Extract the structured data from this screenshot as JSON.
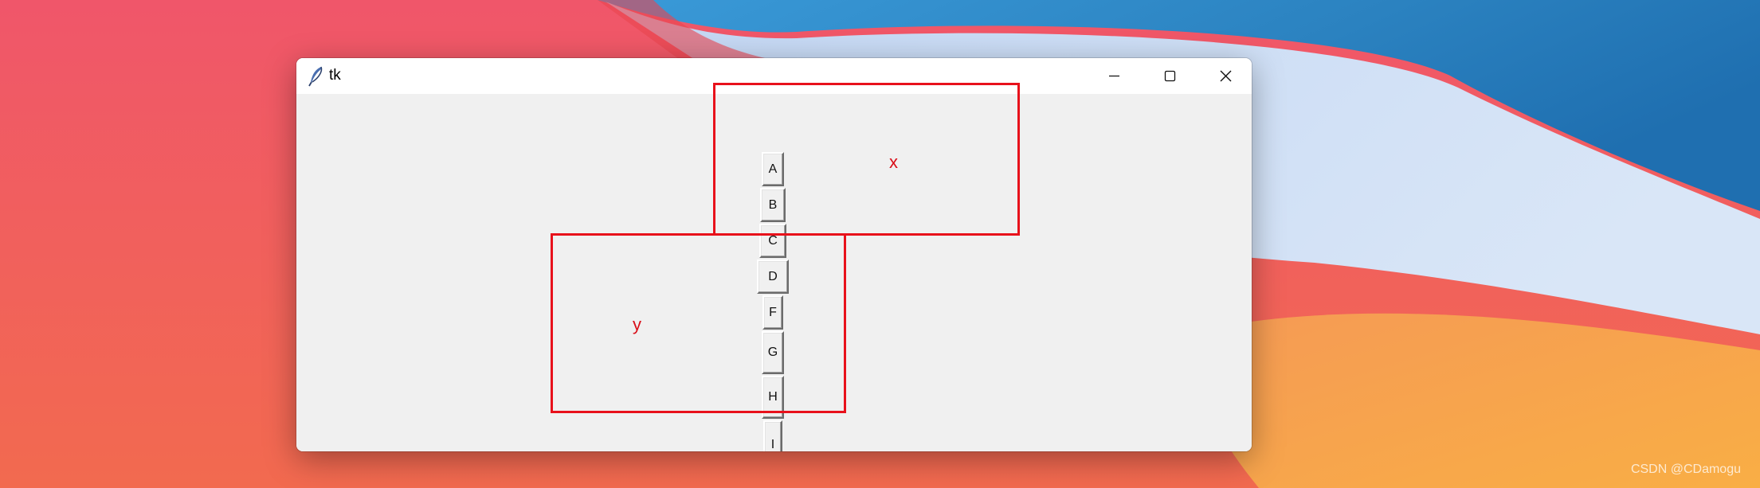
{
  "window": {
    "title": "tk",
    "icon": "tk-feather-icon",
    "controls": [
      "minimize-icon",
      "maximize-icon",
      "close-icon"
    ]
  },
  "buttons": [
    "A",
    "B",
    "C",
    "D",
    "F",
    "G",
    "H",
    "I"
  ],
  "annotations": {
    "x_label": "x",
    "y_label": "y",
    "color": "#e8111b"
  },
  "watermark": "CSDN @CDamogu",
  "colors": {
    "client_bg": "#f0f0f0",
    "titlebar_bg": "#ffffff"
  }
}
